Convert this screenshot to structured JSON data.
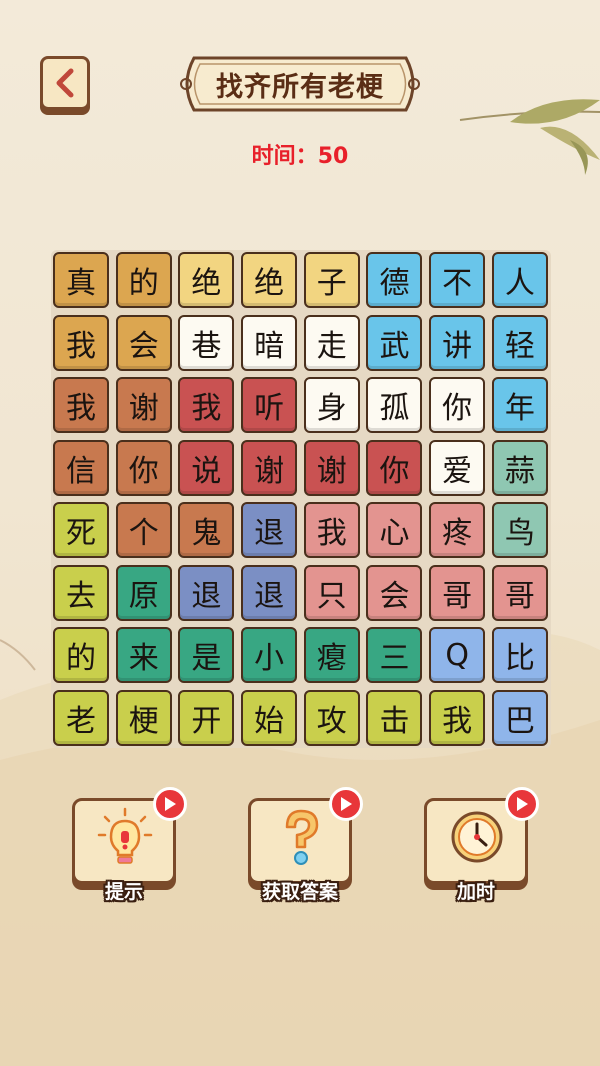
{
  "header": {
    "title": "找齐所有老梗",
    "timer_label": "时间：",
    "timer_value": "50"
  },
  "colors": {
    "orange": "#dca650",
    "yellow": "#f2d581",
    "cream": "#fdfaf2",
    "blue": "#69c5ea",
    "brown": "#c8794f",
    "red": "#c95252",
    "teal": "#8fc7b2",
    "lime": "#c9cf4c",
    "green": "#38a783",
    "slate": "#7b8fc4",
    "pink": "#e39490",
    "lightblue": "#8fb5ea",
    "timer": "#e8202a"
  },
  "grid": [
    [
      {
        "char": "真",
        "color": "orange"
      },
      {
        "char": "的",
        "color": "orange"
      },
      {
        "char": "绝",
        "color": "yellow"
      },
      {
        "char": "绝",
        "color": "yellow"
      },
      {
        "char": "子",
        "color": "yellow"
      },
      {
        "char": "德",
        "color": "blue"
      },
      {
        "char": "不",
        "color": "blue"
      },
      {
        "char": "人",
        "color": "blue"
      }
    ],
    [
      {
        "char": "我",
        "color": "orange"
      },
      {
        "char": "会",
        "color": "orange"
      },
      {
        "char": "巷",
        "color": "cream"
      },
      {
        "char": "暗",
        "color": "cream"
      },
      {
        "char": "走",
        "color": "cream"
      },
      {
        "char": "武",
        "color": "blue"
      },
      {
        "char": "讲",
        "color": "blue"
      },
      {
        "char": "轻",
        "color": "blue"
      }
    ],
    [
      {
        "char": "我",
        "color": "brown"
      },
      {
        "char": "谢",
        "color": "brown"
      },
      {
        "char": "我",
        "color": "red"
      },
      {
        "char": "听",
        "color": "red"
      },
      {
        "char": "身",
        "color": "cream"
      },
      {
        "char": "孤",
        "color": "cream"
      },
      {
        "char": "你",
        "color": "cream"
      },
      {
        "char": "年",
        "color": "blue"
      }
    ],
    [
      {
        "char": "信",
        "color": "brown"
      },
      {
        "char": "你",
        "color": "brown"
      },
      {
        "char": "说",
        "color": "red"
      },
      {
        "char": "谢",
        "color": "red"
      },
      {
        "char": "谢",
        "color": "red"
      },
      {
        "char": "你",
        "color": "red"
      },
      {
        "char": "爱",
        "color": "cream"
      },
      {
        "char": "蒜",
        "color": "teal"
      }
    ],
    [
      {
        "char": "死",
        "color": "lime"
      },
      {
        "char": "个",
        "color": "brown"
      },
      {
        "char": "鬼",
        "color": "brown"
      },
      {
        "char": "退",
        "color": "slate"
      },
      {
        "char": "我",
        "color": "pink"
      },
      {
        "char": "心",
        "color": "pink"
      },
      {
        "char": "疼",
        "color": "pink"
      },
      {
        "char": "鸟",
        "color": "teal"
      }
    ],
    [
      {
        "char": "去",
        "color": "lime"
      },
      {
        "char": "原",
        "color": "green"
      },
      {
        "char": "退",
        "color": "slate"
      },
      {
        "char": "退",
        "color": "slate"
      },
      {
        "char": "只",
        "color": "pink"
      },
      {
        "char": "会",
        "color": "pink"
      },
      {
        "char": "哥",
        "color": "pink"
      },
      {
        "char": "哥",
        "color": "pink"
      }
    ],
    [
      {
        "char": "的",
        "color": "lime"
      },
      {
        "char": "来",
        "color": "green"
      },
      {
        "char": "是",
        "color": "green"
      },
      {
        "char": "小",
        "color": "green"
      },
      {
        "char": "瘪",
        "color": "green"
      },
      {
        "char": "三",
        "color": "green"
      },
      {
        "char": "Q",
        "color": "lightblue"
      },
      {
        "char": "比",
        "color": "lightblue"
      }
    ],
    [
      {
        "char": "老",
        "color": "lime"
      },
      {
        "char": "梗",
        "color": "lime"
      },
      {
        "char": "开",
        "color": "lime"
      },
      {
        "char": "始",
        "color": "lime"
      },
      {
        "char": "攻",
        "color": "lime"
      },
      {
        "char": "击",
        "color": "lime"
      },
      {
        "char": "我",
        "color": "lime"
      },
      {
        "char": "巴",
        "color": "lightblue"
      }
    ]
  ],
  "tools": [
    {
      "label": "提示",
      "icon": "lightbulb-icon"
    },
    {
      "label": "获取答案",
      "icon": "question-mark-icon"
    },
    {
      "label": "加时",
      "icon": "clock-icon"
    }
  ]
}
